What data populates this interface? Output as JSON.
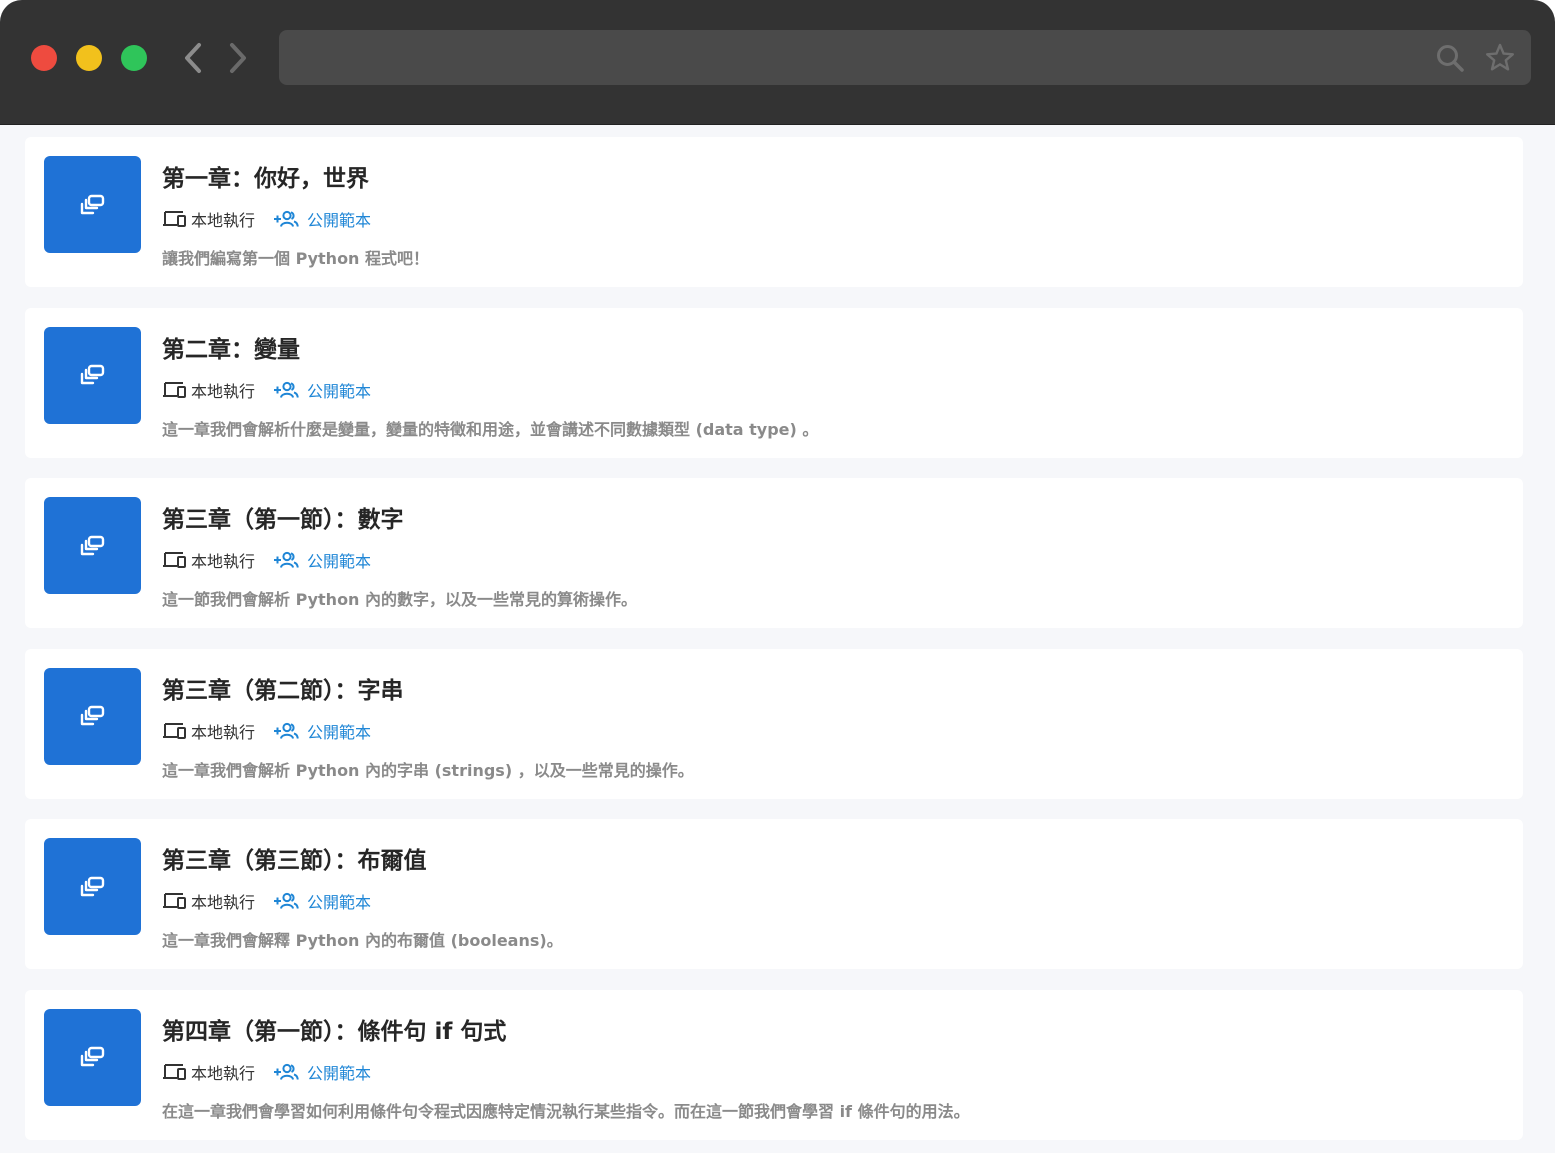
{
  "browser": {
    "icons": {
      "back": "chevron-left-icon",
      "forward": "chevron-right-icon",
      "search": "search-icon",
      "bookmark": "star-icon"
    }
  },
  "colors": {
    "thumb": "#1f72d6",
    "public_link": "#1f86d6",
    "title": "#262626",
    "description": "#8a8a8a"
  },
  "lessons": [
    {
      "title": "第一章：你好，世界",
      "local_label": "本地執行",
      "public_label": "公開範本",
      "description": "讓我們編寫第一個 Python 程式吧！"
    },
    {
      "title": "第二章：變量",
      "local_label": "本地執行",
      "public_label": "公開範本",
      "description": "這一章我們會解析什麼是變量，變量的特徵和用途，並會講述不同數據類型 (data type) 。"
    },
    {
      "title": "第三章（第一節）：數字",
      "local_label": "本地執行",
      "public_label": "公開範本",
      "description": "這一節我們會解析 Python 內的數字，以及一些常見的算術操作。"
    },
    {
      "title": "第三章（第二節）：字串",
      "local_label": "本地執行",
      "public_label": "公開範本",
      "description": "這一章我們會解析 Python 內的字串 (strings) ，以及一些常見的操作。"
    },
    {
      "title": "第三章（第三節）：布爾值",
      "local_label": "本地執行",
      "public_label": "公開範本",
      "description": "這一章我們會解釋 Python 內的布爾值 (booleans)。"
    },
    {
      "title": "第四章（第一節）：條件句 if 句式",
      "local_label": "本地執行",
      "public_label": "公開範本",
      "description": "在這一章我們會學習如何利用條件句令程式因應特定情況執行某些指令。而在這一節我們會學習 if 條件句的用法。"
    }
  ]
}
